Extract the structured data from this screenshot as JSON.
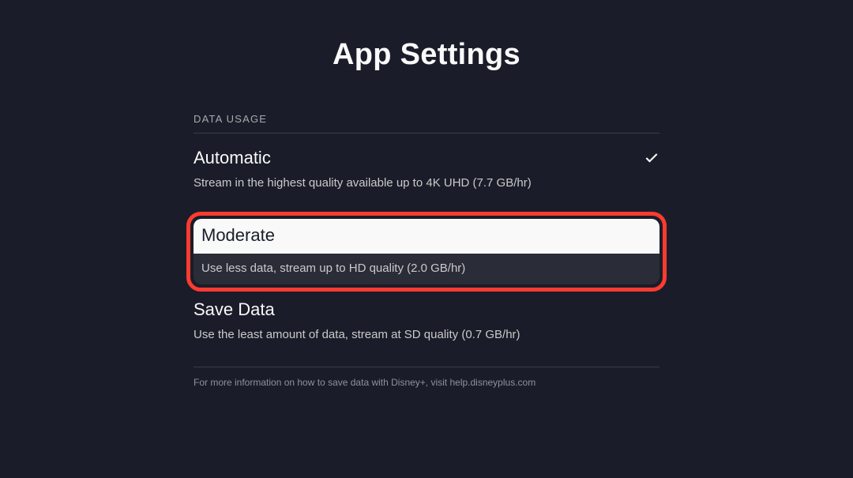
{
  "page": {
    "title": "App Settings"
  },
  "section": {
    "header": "DATA USAGE",
    "options": [
      {
        "title": "Automatic",
        "description": "Stream in the highest quality available up to 4K UHD (7.7 GB/hr)"
      },
      {
        "title": "Moderate",
        "description": "Use less data, stream up to HD quality (2.0 GB/hr)"
      },
      {
        "title": "Save Data",
        "description": "Use the least amount of data, stream at SD quality (0.7 GB/hr)"
      }
    ],
    "footer": "For more information on how to save data with Disney+, visit help.disneyplus.com"
  }
}
